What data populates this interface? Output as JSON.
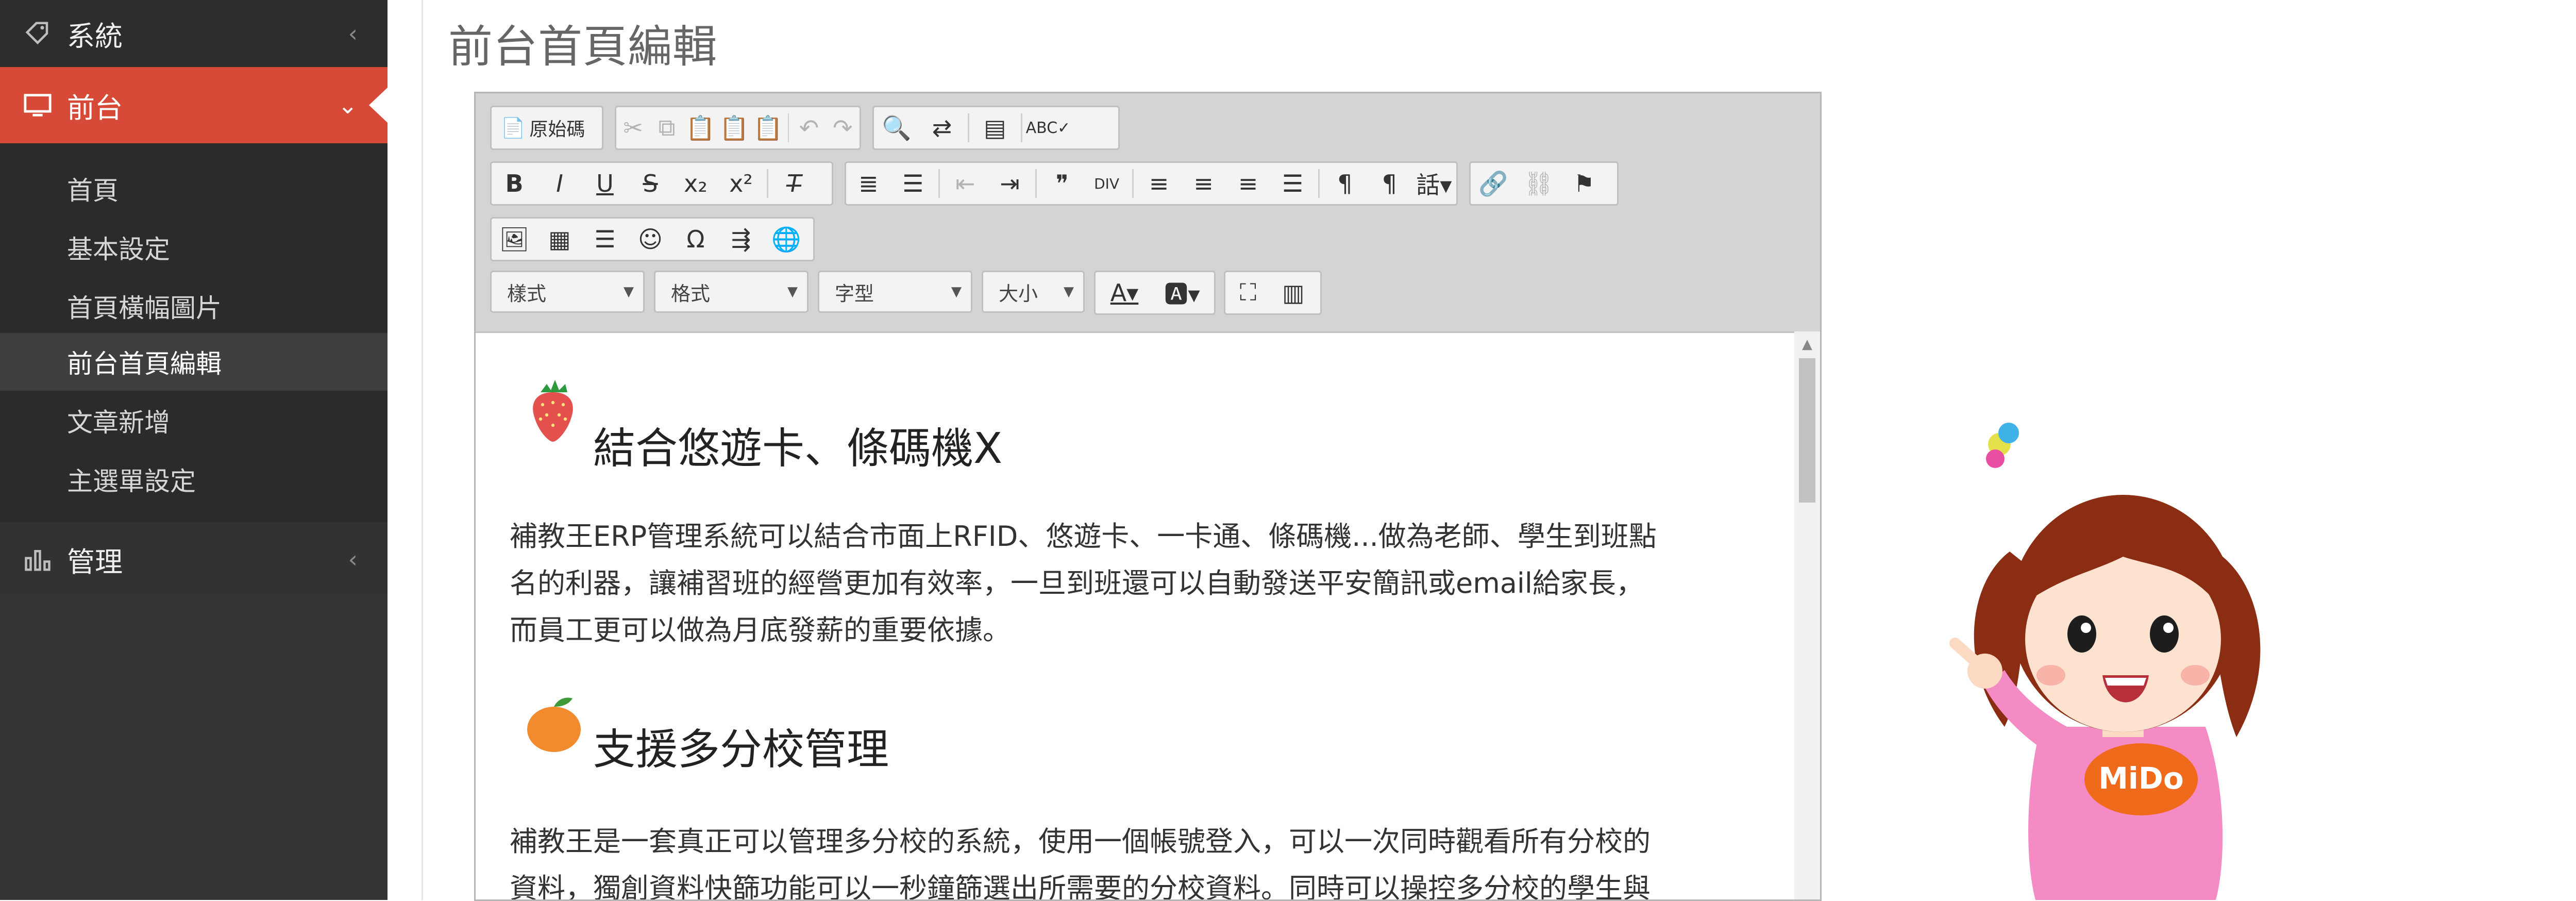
{
  "sidebar": {
    "items": [
      {
        "label": "系統",
        "icon": "tag-icon"
      },
      {
        "label": "前台",
        "icon": "monitor-icon"
      },
      {
        "label": "管理",
        "icon": "bar-chart-icon"
      }
    ],
    "submenu": [
      "首頁",
      "基本設定",
      "首頁橫幅圖片",
      "前台首頁編輯",
      "文章新增",
      "主選單設定"
    ],
    "active_submenu": "前台首頁編輯",
    "colors": {
      "background": "#333333",
      "active": "#d74a37"
    }
  },
  "page": {
    "title": "前台首頁編輯"
  },
  "editor": {
    "source_label": "原始碼",
    "combos": {
      "style": "樣式",
      "format": "格式",
      "font": "字型",
      "size": "大小"
    },
    "toolbar_icons": {
      "row1": [
        "cut-icon",
        "copy-icon",
        "paste-icon",
        "paste-text-icon",
        "paste-word-icon",
        "undo-icon",
        "redo-icon",
        "find-icon",
        "replace-icon",
        "select-all-icon",
        "spellcheck-icon"
      ],
      "row2": [
        "bold-icon",
        "italic-icon",
        "underline-icon",
        "strike-icon",
        "subscript-icon",
        "superscript-icon",
        "remove-format-icon",
        "numbered-list-icon",
        "bulleted-list-icon",
        "outdent-icon",
        "indent-icon",
        "blockquote-icon",
        "div-icon",
        "align-left-icon",
        "align-center-icon",
        "align-right-icon",
        "justify-icon",
        "ltr-icon",
        "rtl-icon",
        "language-icon",
        "link-icon",
        "unlink-icon",
        "anchor-icon"
      ],
      "row3": [
        "image-icon",
        "table-icon",
        "horizontal-rule-icon",
        "smiley-icon",
        "special-char-icon",
        "page-break-icon",
        "iframe-icon"
      ],
      "row4": [
        "text-color-icon",
        "bg-color-icon",
        "maximize-icon",
        "show-blocks-icon"
      ]
    },
    "content": {
      "sections": [
        {
          "icon": "strawberry-icon",
          "heading": "結合悠遊卡、條碼機X",
          "lines": [
            "補教王ERP管理系統可以結合市面上RFID、悠遊卡、一卡通、條碼機...做為老師、學生到班點",
            "名的利器，讓補習班的經營更加有效率，一旦到班還可以自動發送平安簡訊或email給家長，",
            "而員工更可以做為月底發薪的重要依據。"
          ]
        },
        {
          "icon": "orange-icon",
          "heading": "支援多分校管理",
          "lines": [
            "補教王是一套真正可以管理多分校的系統，使用一個帳號登入，可以一次同時觀看所有分校的",
            "資料，獨創資料快篩功能可以一秒鐘篩選出所需要的分校資料。同時可以操控多分校的學生與"
          ]
        }
      ]
    }
  },
  "mascot": {
    "badge": "MiDo"
  }
}
